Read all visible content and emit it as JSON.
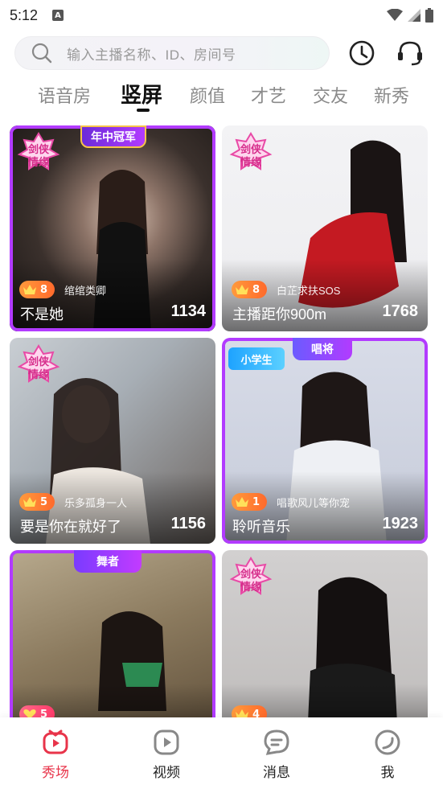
{
  "status_bar": {
    "time": "5:12",
    "notification_letter": "A"
  },
  "search": {
    "placeholder": "输入主播名称、ID、房间号"
  },
  "tabs": [
    {
      "label": "语音房",
      "active": false
    },
    {
      "label": "竖屏",
      "active": true
    },
    {
      "label": "颜值",
      "active": false
    },
    {
      "label": "才艺",
      "active": false
    },
    {
      "label": "交友",
      "active": false
    },
    {
      "label": "新秀",
      "active": false
    }
  ],
  "cards": [
    {
      "sticker": "剑侠情缘",
      "ribbon": "年中冠军",
      "level": "8",
      "host": "绾绾类卿",
      "title": "不是她",
      "viewers": "1134"
    },
    {
      "sticker": "剑侠情缘",
      "ribbon": "",
      "level": "8",
      "host": "白芷求扶SOS",
      "title": "主播距你900m",
      "viewers": "1768"
    },
    {
      "sticker": "剑侠情缘",
      "ribbon": "",
      "level": "5",
      "host": "乐多孤身一人",
      "title": "要是你在就好了",
      "viewers": "1156"
    },
    {
      "sticker": "",
      "ribbon": "唱将",
      "badge": "小学生",
      "level": "1",
      "host": "唱歌风儿等你宠",
      "title": "聆听音乐",
      "viewers": "1923"
    },
    {
      "sticker": "",
      "ribbon": "舞者",
      "level": "5",
      "host": "",
      "title": "",
      "viewers": ""
    },
    {
      "sticker": "剑侠情缘",
      "ribbon": "",
      "level": "4",
      "host": "",
      "title": "",
      "viewers": ""
    }
  ],
  "bottom_nav": [
    {
      "label": "秀场",
      "icon": "live-show-icon",
      "active": true
    },
    {
      "label": "视频",
      "icon": "video-play-icon",
      "active": false
    },
    {
      "label": "消息",
      "icon": "message-icon",
      "active": false
    },
    {
      "label": "我",
      "icon": "profile-icon",
      "active": false
    }
  ],
  "colors": {
    "accent": "#e8344a",
    "level_badge": "#ff7a2c",
    "frame_purple": "#b23bff"
  }
}
